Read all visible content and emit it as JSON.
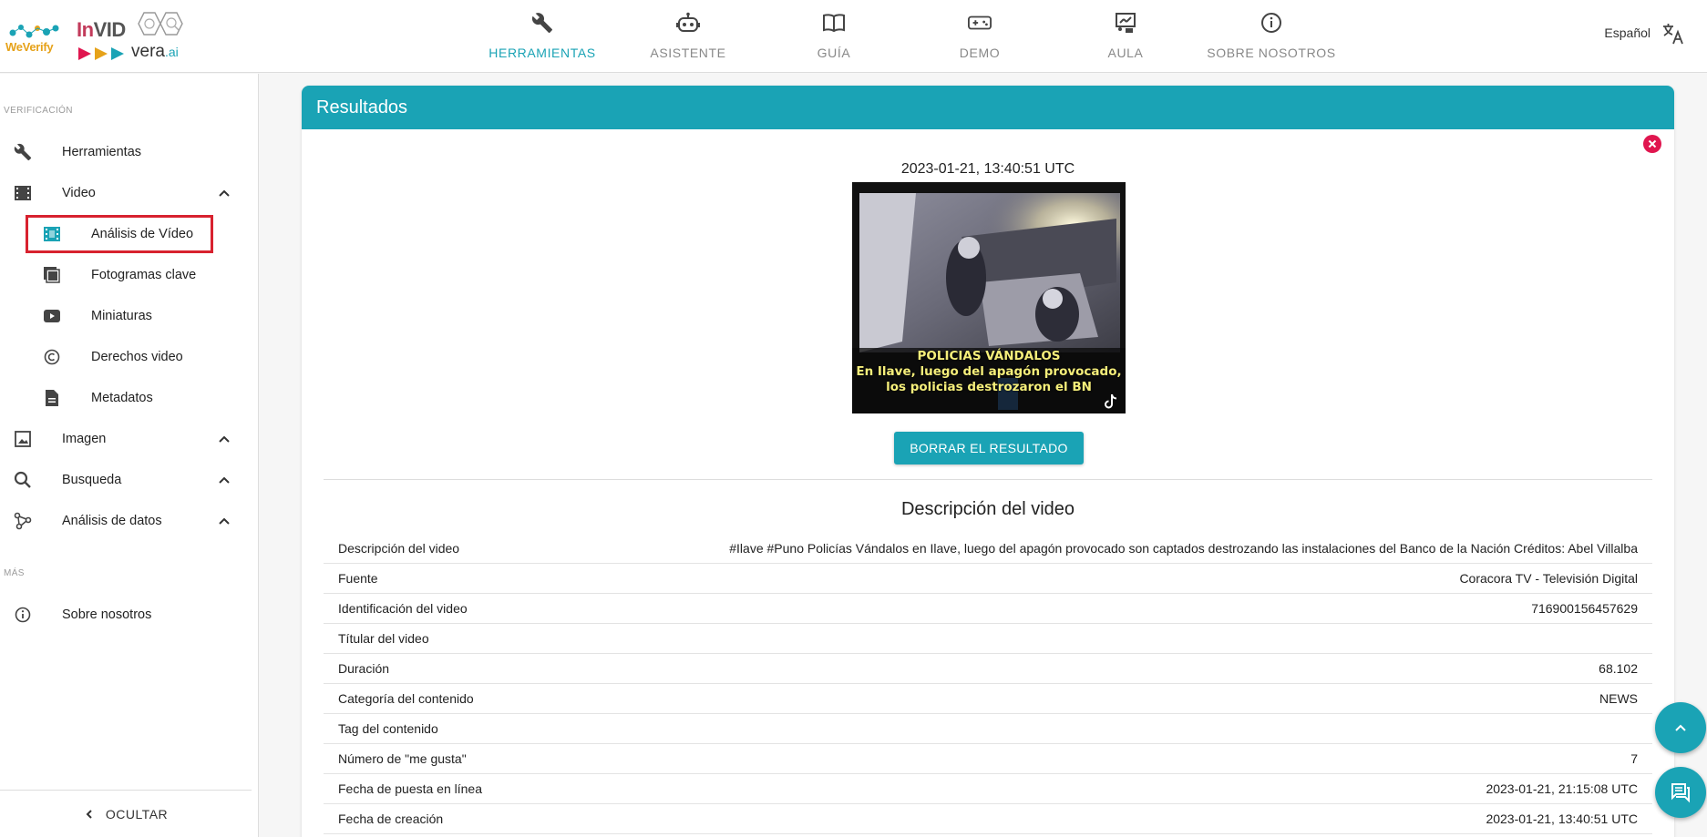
{
  "brand": {
    "weverify": "WeVerify",
    "invid_prefix": "In",
    "invid_suffix": "VID",
    "vera": "vera",
    "vera_suffix": ".ai"
  },
  "nav": [
    {
      "label": "HERRAMIENTAS",
      "icon": "wrench-icon",
      "active": true
    },
    {
      "label": "ASISTENTE",
      "icon": "robot-icon",
      "active": false
    },
    {
      "label": "GUÍA",
      "icon": "book-icon",
      "active": false
    },
    {
      "label": "DEMO",
      "icon": "gamepad-icon",
      "active": false
    },
    {
      "label": "AULA",
      "icon": "classroom-icon",
      "active": false
    },
    {
      "label": "SOBRE NOSOTROS",
      "icon": "info-icon",
      "active": false
    }
  ],
  "language": {
    "label": "Español",
    "icon": "translate-icon"
  },
  "sidebar": {
    "section_verification": "VERIFICACIÓN",
    "section_more": "MÁS",
    "items": [
      {
        "label": "Herramientas",
        "icon": "wrench-icon"
      },
      {
        "label": "Video",
        "icon": "film-icon",
        "expanded": true
      },
      {
        "label": "Análisis de Vídeo",
        "icon": "video-analysis-icon",
        "selected": true
      },
      {
        "label": "Fotogramas clave",
        "icon": "keyframes-icon"
      },
      {
        "label": "Miniaturas",
        "icon": "youtube-icon"
      },
      {
        "label": "Derechos video",
        "icon": "copyright-icon"
      },
      {
        "label": "Metadatos",
        "icon": "document-icon"
      },
      {
        "label": "Imagen",
        "icon": "image-icon"
      },
      {
        "label": "Busqueda",
        "icon": "search-icon"
      },
      {
        "label": "Análisis de datos",
        "icon": "graph-icon"
      },
      {
        "label": "Sobre nosotros",
        "icon": "info-icon"
      }
    ],
    "hide_label": "OCULTAR"
  },
  "results": {
    "title": "Resultados",
    "timestamp": "2023-01-21, 13:40:51 UTC",
    "thumbnail_caption": [
      "POLICIAS VÁNDALOS",
      "En Ilave, luego del apagón provocado,",
      "los policias destrozaron el BN"
    ],
    "clear_button": "BORRAR EL RESULTADO",
    "description_title": "Descripción del video",
    "rows": [
      {
        "key": "Descripción del video",
        "value": "#Ilave #Puno Policías Vándalos en Ilave, luego del apagón provocado son captados destrozando las instalaciones del Banco de la Nación Créditos: Abel Villalba"
      },
      {
        "key": "Fuente",
        "value": "Coracora TV - Televisión Digital"
      },
      {
        "key": "Identificación del video",
        "value": "716900156457629"
      },
      {
        "key": "Títular del video",
        "value": ""
      },
      {
        "key": "Duración",
        "value": "68.102"
      },
      {
        "key": "Categoría del contenido",
        "value": "NEWS"
      },
      {
        "key": "Tag del contenido",
        "value": ""
      },
      {
        "key": "Número de \"me gusta\"",
        "value": "7"
      },
      {
        "key": "Fecha de puesta en línea",
        "value": "2023-01-21, 21:15:08 UTC"
      },
      {
        "key": "Fecha de creación",
        "value": "2023-01-21, 13:40:51 UTC"
      }
    ]
  },
  "colors": {
    "accent": "#1aa3b5",
    "close": "#e0164f",
    "selection": "#d8222f"
  }
}
